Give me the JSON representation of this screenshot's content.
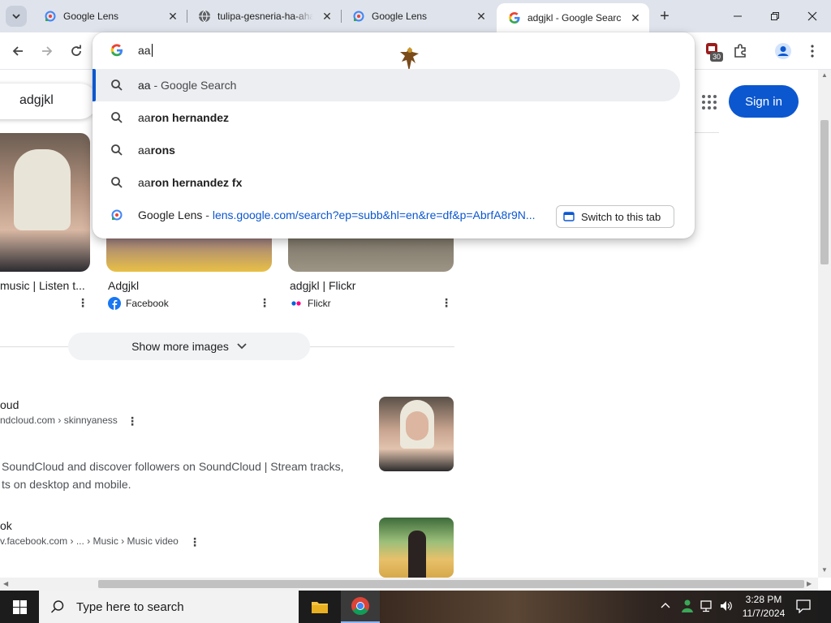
{
  "tabs": [
    {
      "title": "Google Lens",
      "favicon": "google-lens-icon"
    },
    {
      "title": "tulipa-gesneria-ha-aha",
      "favicon": "globe-icon"
    },
    {
      "title": "Google Lens",
      "favicon": "google-lens-icon"
    },
    {
      "title": "adgjkl - Google Search",
      "favicon": "google-g-icon",
      "active": true
    }
  ],
  "omnibox": {
    "typed": "aa",
    "suggestions": [
      {
        "prefix": "aa",
        "rest": " - Google Search",
        "selected": true
      },
      {
        "prefix": "aa",
        "rest": "ron hernandez"
      },
      {
        "prefix": "aa",
        "rest": "rons"
      },
      {
        "prefix": "aa",
        "rest": "ron hernandez fx"
      }
    ],
    "tab_match": {
      "title": "Google Lens",
      "sep": " - ",
      "url": "lens.google.com/search?ep=subb&hl=en&re=df&p=AbrfA8r9N...",
      "button": "Switch to this tab"
    }
  },
  "toolbar": {
    "extension_badge": "30"
  },
  "page": {
    "search_query": "adgjkl",
    "sign_in": "Sign in",
    "images": [
      {
        "title": "music | Listen t...",
        "source": ""
      },
      {
        "title": "Adgjkl",
        "source": "Facebook"
      },
      {
        "title": "adgjkl | Flickr",
        "source": "Flickr"
      }
    ],
    "show_more": "Show more images",
    "results": [
      {
        "title": "oud",
        "url": "ndcloud.com › skinnyaness",
        "snippet1": "SoundCloud and discover followers on SoundCloud | Stream tracks,",
        "snippet2": "ts on desktop and mobile."
      },
      {
        "title": "ok",
        "url": "v.facebook.com › ... › Music › Music video"
      }
    ]
  },
  "taskbar": {
    "search_placeholder": "Type here to search",
    "time": "3:28 PM",
    "date": "11/7/2024"
  },
  "colors": {
    "accent": "#0b57d0",
    "tabstrip": "#dfe3eb",
    "taskbar": "#1c1c1c"
  }
}
